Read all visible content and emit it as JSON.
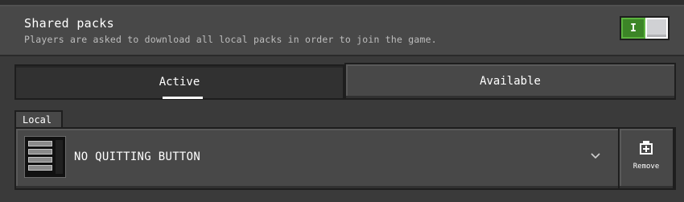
{
  "shared_packs": {
    "title": "Shared packs",
    "description": "Players are asked to download all local packs in order to join the game.",
    "toggle": {
      "state": "on",
      "on_glyph": "I"
    }
  },
  "tabs": [
    {
      "label": "Active",
      "selected": true
    },
    {
      "label": "Available",
      "selected": false
    }
  ],
  "section_label": "Local",
  "packs": [
    {
      "name": "NO QUITTING BUTTON",
      "thumbnail_icon": "pack-thumbnail",
      "expand_icon": "chevron-down-icon",
      "remove_label": "Remove",
      "remove_icon": "remove-pack-icon"
    }
  ],
  "colors": {
    "background": "#3a3a3a",
    "panel": "#484848",
    "dark_panel": "#313131",
    "border": "#1e1e1e",
    "toggle_on": "#3c8527",
    "text": "#ffffff",
    "subtext": "#bdbdbd"
  }
}
